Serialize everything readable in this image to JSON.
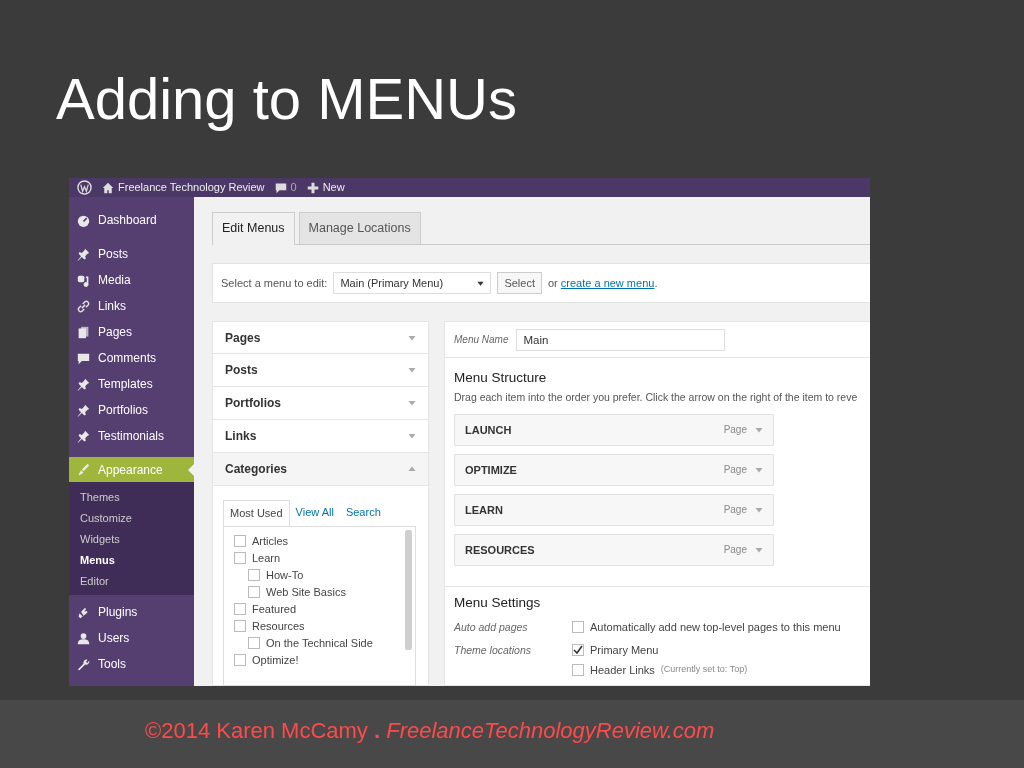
{
  "slide": {
    "title": "Adding to MENUs",
    "footer": "©2014 Karen McCamy **.** *FreelanceTechnologyReview.com*"
  },
  "admin_bar": {
    "site": "Freelance Technology Review",
    "comments": "0",
    "new": "New"
  },
  "sidebar": {
    "items": [
      {
        "label": "Dashboard",
        "selected": false
      },
      {
        "label": "Posts",
        "selected": false
      },
      {
        "label": "Media",
        "selected": false
      },
      {
        "label": "Links",
        "selected": false
      },
      {
        "label": "Pages",
        "selected": false
      },
      {
        "label": "Comments",
        "selected": false
      },
      {
        "label": "Templates",
        "selected": false
      },
      {
        "label": "Portfolios",
        "selected": false
      },
      {
        "label": "Testimonials",
        "selected": false
      },
      {
        "label": "Appearance",
        "selected": true,
        "children": [
          {
            "label": "Themes",
            "selected": false
          },
          {
            "label": "Customize",
            "selected": false
          },
          {
            "label": "Widgets",
            "selected": false
          },
          {
            "label": "Menus",
            "selected": true
          },
          {
            "label": "Editor",
            "selected": false
          }
        ]
      },
      {
        "label": "Plugins",
        "selected": false
      },
      {
        "label": "Users",
        "selected": false
      },
      {
        "label": "Tools",
        "selected": false
      }
    ]
  },
  "tabs": [
    {
      "label": "Edit Menus",
      "selected": true
    },
    {
      "label": "Manage Locations",
      "selected": false
    }
  ],
  "menu_select": {
    "label": "Select a menu to edit:",
    "value": "Main (Primary Menu)",
    "button": "Select",
    "prefix": "or",
    "link": "create a new menu",
    "suffix": "."
  },
  "accordion": [
    {
      "label": "Pages",
      "expanded": false
    },
    {
      "label": "Posts",
      "expanded": false
    },
    {
      "label": "Portfolios",
      "expanded": false
    },
    {
      "label": "Links",
      "expanded": false
    },
    {
      "label": "Categories",
      "expanded": true
    }
  ],
  "category_tabs": [
    {
      "label": "Most Used",
      "selected": true
    },
    {
      "label": "View All",
      "selected": false
    },
    {
      "label": "Search",
      "selected": false
    }
  ],
  "categories": [
    {
      "label": "Articles",
      "checked": false
    },
    {
      "label": "Learn",
      "checked": false,
      "children": [
        {
          "label": "How-To",
          "checked": false
        },
        {
          "label": "Web Site Basics",
          "checked": false
        }
      ]
    },
    {
      "label": "Featured",
      "checked": false
    },
    {
      "label": "Resources",
      "checked": false,
      "children": [
        {
          "label": "On the Technical Side",
          "checked": false
        }
      ]
    },
    {
      "label": "Optimize!",
      "checked": false
    }
  ],
  "menu_name": {
    "label": "Menu Name",
    "value": "Main"
  },
  "structure": {
    "title": "Menu Structure",
    "description": "Drag each item into the order you prefer. Click the arrow on the right of the item to reve",
    "items": [
      {
        "label": "LAUNCH",
        "type": "Page"
      },
      {
        "label": "OPTIMIZE",
        "type": "Page"
      },
      {
        "label": "LEARN",
        "type": "Page"
      },
      {
        "label": "RESOURCES",
        "type": "Page"
      }
    ]
  },
  "settings": {
    "title": "Menu Settings",
    "rows": [
      {
        "label": "Auto add pages",
        "options": [
          {
            "text": "Automatically add new top-level pages to this menu",
            "checked": false
          }
        ]
      },
      {
        "label": "Theme locations",
        "options": [
          {
            "text": "Primary Menu",
            "checked": true
          },
          {
            "text": "Header Links",
            "note": "(Currently set to: Top)",
            "checked": false
          }
        ]
      }
    ]
  }
}
